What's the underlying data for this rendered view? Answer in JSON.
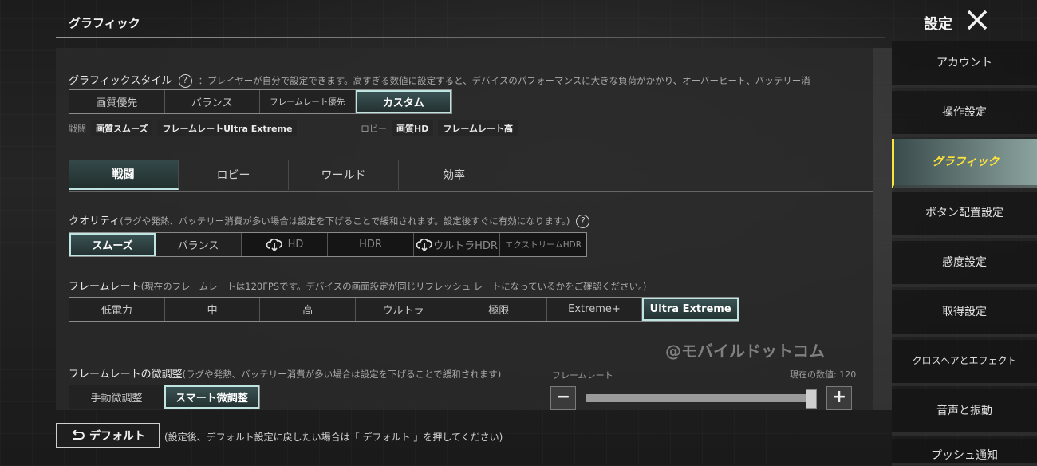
{
  "header": {
    "page_title": "グラフィック",
    "settings_label": "設定"
  },
  "graphic_style": {
    "label": "グラフィックスタイル",
    "help": "?",
    "note": "：プレイヤーが自分で設定できます。高すぎる数値に設定すると、デバイスのパフォーマンスに大きな負荷がかかり、オーバーヒート、バッテリー消",
    "options": [
      "画質優先",
      "バランス",
      "フレームレート優先",
      "カスタム"
    ],
    "selected": "カスタム",
    "battle_label": "戦闘",
    "battle_tags": [
      "画質スムーズ",
      "フレームレートUltra Extreme"
    ],
    "lobby_label": "ロビー",
    "lobby_tags": [
      "画質HD",
      "フレームレート高"
    ]
  },
  "tabs": [
    "戦闘",
    "ロビー",
    "ワールド",
    "効率"
  ],
  "selected_tab": "戦闘",
  "quality": {
    "label": "クオリティ",
    "note": "(ラグや発熱、バッテリー消費が多い場合は設定を下げることで緩和されます。設定後すぐに有効になります。)",
    "help": "?",
    "options": [
      "スムーズ",
      "バランス",
      "HD",
      "HDR",
      "ウルトラHDR",
      "エクストリームHDR"
    ],
    "selected": "スムーズ"
  },
  "framerate": {
    "label": "フレームレート",
    "note": "(現在のフレームレートは120FPSです。デバイスの画面設定が同じリフレッシュ レートになっているかをご確認ください。)",
    "options": [
      "低電力",
      "中",
      "高",
      "ウルトラ",
      "極限",
      "Extreme+",
      "Ultra Extreme"
    ],
    "selected": "Ultra Extreme"
  },
  "fine_tune": {
    "label": "フレームレートの微調整",
    "note": "(ラグや発熱、バッテリー消費が多い場合は設定を下げることで緩和されます)",
    "options": [
      "手動微調整",
      "スマート微調整"
    ],
    "selected": "スマート微調整",
    "slider_label": "フレームレート",
    "current_label": "現在の数値: 120",
    "minus": "−",
    "plus": "+",
    "slider_level": 0.98
  },
  "watermark": "@モバイルドットコム",
  "footer": {
    "default_label": "デフォルト",
    "default_note": "(設定後、デフォルト設定に戻したい場合は「 デフォルト 」を押してください)"
  },
  "sidebar": {
    "items": [
      {
        "label": "アカウント"
      },
      {
        "label": "操作設定"
      },
      {
        "label": "グラフィック"
      },
      {
        "label": "ボタン配置設定"
      },
      {
        "label": "感度設定"
      },
      {
        "label": "取得設定"
      },
      {
        "label": "クロスヘアとエフェクト"
      },
      {
        "label": "音声と振動"
      },
      {
        "label": "プッシュ通知"
      }
    ],
    "selected": "グラフィック"
  },
  "colors": {
    "accent": "#bfe5e2",
    "selected_sidebar_text": "#ffe23a"
  }
}
